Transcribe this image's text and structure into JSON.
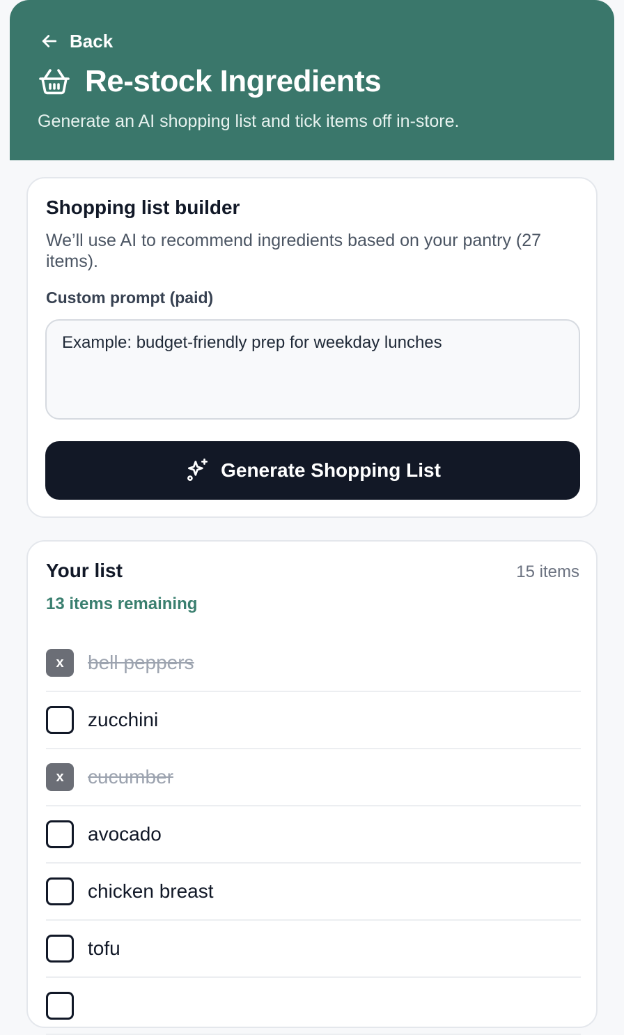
{
  "header": {
    "back_label": "Back",
    "title": "Re-stock Ingredients",
    "subtitle": "Generate an AI shopping list and tick items off in-store.",
    "color": "#3a776b"
  },
  "builder": {
    "title": "Shopping list builder",
    "description": "We’ll use AI to recommend ingredients based on your pantry (27 items).",
    "prompt_label": "Custom prompt (paid)",
    "prompt_placeholder": "Example: budget-friendly prep for weekday lunches",
    "generate_label": "Generate Shopping List"
  },
  "list": {
    "title": "Your list",
    "count": "15 items",
    "remaining": "13 items remaining",
    "check_mark": "x",
    "items": [
      {
        "label": "bell peppers",
        "checked": true
      },
      {
        "label": "zucchini",
        "checked": false
      },
      {
        "label": "cucumber",
        "checked": true
      },
      {
        "label": "avocado",
        "checked": false
      },
      {
        "label": "chicken breast",
        "checked": false
      },
      {
        "label": "tofu",
        "checked": false
      },
      {
        "label": "",
        "checked": false
      }
    ]
  },
  "icons": {
    "back": "arrow-left-icon",
    "title": "basket-icon",
    "generate": "sparkles-icon"
  }
}
